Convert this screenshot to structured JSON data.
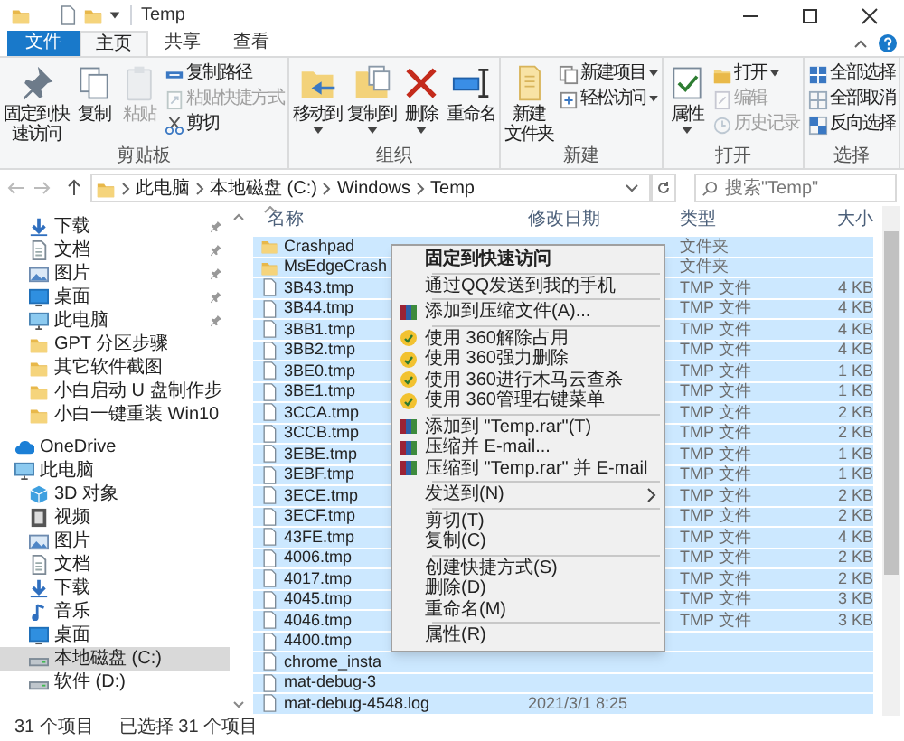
{
  "window": {
    "title": "Temp"
  },
  "ribbon_tabs": [
    {
      "label": "文件",
      "kind": "file",
      "selected": false
    },
    {
      "label": "主页",
      "kind": "tab",
      "selected": true
    },
    {
      "label": "共享",
      "kind": "tab",
      "selected": false
    },
    {
      "label": "查看",
      "kind": "tab",
      "selected": false
    }
  ],
  "ribbon_groups": [
    {
      "label": "剪贴板",
      "buttons": [
        {
          "label": [
            "固定到快",
            "速访问"
          ],
          "kind": "large",
          "disabled": false,
          "dropdown": false
        },
        {
          "label": "复制",
          "kind": "large",
          "disabled": false,
          "dropdown": false
        },
        {
          "label": "粘贴",
          "kind": "large",
          "disabled": true,
          "dropdown": false
        },
        {
          "label": "复制路径",
          "kind": "small",
          "disabled": false,
          "dropdown": false
        },
        {
          "label": "粘贴快捷方式",
          "kind": "small",
          "disabled": true,
          "dropdown": false
        },
        {
          "label": "剪切",
          "kind": "small",
          "disabled": false,
          "dropdown": false
        }
      ]
    },
    {
      "label": "组织",
      "buttons": [
        {
          "label": "移动到",
          "kind": "large",
          "disabled": false,
          "dropdown": true
        },
        {
          "label": "复制到",
          "kind": "large",
          "disabled": false,
          "dropdown": true
        },
        {
          "label": "删除",
          "kind": "large",
          "disabled": false,
          "dropdown": true
        },
        {
          "label": "重命名",
          "kind": "large",
          "disabled": false,
          "dropdown": false
        }
      ]
    },
    {
      "label": "新建",
      "buttons": [
        {
          "label": [
            "新建",
            "文件夹"
          ],
          "kind": "large",
          "disabled": false,
          "dropdown": false
        },
        {
          "label": "新建项目",
          "kind": "small",
          "disabled": false,
          "dropdown": true
        },
        {
          "label": "轻松访问",
          "kind": "small",
          "disabled": false,
          "dropdown": true
        }
      ]
    },
    {
      "label": "打开",
      "buttons": [
        {
          "label": "属性",
          "kind": "large",
          "disabled": false,
          "dropdown": true
        },
        {
          "label": "打开",
          "kind": "small",
          "disabled": false,
          "dropdown": true
        },
        {
          "label": "编辑",
          "kind": "small",
          "disabled": true,
          "dropdown": false
        },
        {
          "label": "历史记录",
          "kind": "small",
          "disabled": true,
          "dropdown": false
        }
      ]
    },
    {
      "label": "选择",
      "buttons": [
        {
          "label": "全部选择",
          "kind": "small",
          "disabled": false,
          "dropdown": false
        },
        {
          "label": "全部取消",
          "kind": "small",
          "disabled": false,
          "dropdown": false
        },
        {
          "label": "反向选择",
          "kind": "small",
          "disabled": false,
          "dropdown": false
        }
      ]
    }
  ],
  "address": {
    "path": [
      "此电脑",
      "本地磁盘 (C:)",
      "Windows",
      "Temp"
    ]
  },
  "search": {
    "placeholder": "搜索\"Temp\""
  },
  "navigation": {
    "quick_access": [
      {
        "label": "下载",
        "kind": "download",
        "pinned": true
      },
      {
        "label": "文档",
        "kind": "document",
        "pinned": true
      },
      {
        "label": "图片",
        "kind": "picture",
        "pinned": true
      },
      {
        "label": "桌面",
        "kind": "desktop",
        "pinned": true
      },
      {
        "label": "此电脑",
        "kind": "computer",
        "pinned": true
      },
      {
        "label": "GPT 分区步骤",
        "kind": "folder",
        "pinned": false
      },
      {
        "label": "其它软件截图",
        "kind": "folder",
        "pinned": false
      },
      {
        "label": "小白启动 U 盘制作步",
        "kind": "folder",
        "pinned": false
      },
      {
        "label": "小白一键重装 Win10",
        "kind": "folder",
        "pinned": false
      }
    ],
    "tree": [
      {
        "label": "OneDrive",
        "kind": "cloud",
        "selected": false
      },
      {
        "label": "此电脑",
        "kind": "computer",
        "selected": false,
        "children": [
          {
            "label": "3D 对象",
            "kind": "cube",
            "selected": false
          },
          {
            "label": "视频",
            "kind": "video",
            "selected": false
          },
          {
            "label": "图片",
            "kind": "picture",
            "selected": false
          },
          {
            "label": "文档",
            "kind": "document",
            "selected": false
          },
          {
            "label": "下载",
            "kind": "download",
            "selected": false
          },
          {
            "label": "音乐",
            "kind": "music",
            "selected": false
          },
          {
            "label": "桌面",
            "kind": "desktop",
            "selected": false
          },
          {
            "label": "本地磁盘 (C:)",
            "kind": "drive",
            "selected": true
          },
          {
            "label": "软件 (D:)",
            "kind": "drive",
            "selected": false
          }
        ]
      }
    ]
  },
  "file_list": {
    "columns": [
      "名称",
      "修改日期",
      "类型",
      "大小"
    ],
    "rows": [
      {
        "name": "Crashpad",
        "kind": "folder",
        "type": "文件夹",
        "selected": true
      },
      {
        "name": "MsEdgeCrash",
        "kind": "folder",
        "type": "文件夹",
        "selected": true
      },
      {
        "name": "3B43.tmp",
        "kind": "file",
        "type": "TMP 文件",
        "size": "4 KB",
        "selected": true
      },
      {
        "name": "3B44.tmp",
        "kind": "file",
        "type": "TMP 文件",
        "size": "4 KB",
        "selected": true
      },
      {
        "name": "3BB1.tmp",
        "kind": "file",
        "type": "TMP 文件",
        "size": "4 KB",
        "selected": true
      },
      {
        "name": "3BB2.tmp",
        "kind": "file",
        "type": "TMP 文件",
        "size": "4 KB",
        "selected": true
      },
      {
        "name": "3BE0.tmp",
        "kind": "file",
        "type": "TMP 文件",
        "size": "1 KB",
        "selected": true
      },
      {
        "name": "3BE1.tmp",
        "kind": "file",
        "type": "TMP 文件",
        "size": "1 KB",
        "selected": true
      },
      {
        "name": "3CCA.tmp",
        "kind": "file",
        "type": "TMP 文件",
        "size": "2 KB",
        "selected": true
      },
      {
        "name": "3CCB.tmp",
        "kind": "file",
        "type": "TMP 文件",
        "size": "2 KB",
        "selected": true
      },
      {
        "name": "3EBE.tmp",
        "kind": "file",
        "type": "TMP 文件",
        "size": "1 KB",
        "selected": true
      },
      {
        "name": "3EBF.tmp",
        "kind": "file",
        "type": "TMP 文件",
        "size": "1 KB",
        "selected": true
      },
      {
        "name": "3ECE.tmp",
        "kind": "file",
        "type": "TMP 文件",
        "size": "2 KB",
        "selected": true
      },
      {
        "name": "3ECF.tmp",
        "kind": "file",
        "type": "TMP 文件",
        "size": "2 KB",
        "selected": true
      },
      {
        "name": "43FE.tmp",
        "kind": "file",
        "type": "TMP 文件",
        "size": "4 KB",
        "selected": true
      },
      {
        "name": "4006.tmp",
        "kind": "file",
        "type": "TMP 文件",
        "size": "2 KB",
        "selected": true
      },
      {
        "name": "4017.tmp",
        "kind": "file",
        "type": "TMP 文件",
        "size": "2 KB",
        "selected": true
      },
      {
        "name": "4045.tmp",
        "kind": "file",
        "type": "TMP 文件",
        "size": "3 KB",
        "selected": true
      },
      {
        "name": "4046.tmp",
        "kind": "file",
        "type": "TMP 文件",
        "size": "3 KB",
        "selected": true
      },
      {
        "name": "4400.tmp",
        "kind": "file",
        "selected": true
      },
      {
        "name": "chrome_insta",
        "kind": "file",
        "selected": true
      },
      {
        "name": "mat-debug-3",
        "kind": "file",
        "selected": true
      },
      {
        "name": "mat-debug-4548.log",
        "kind": "file",
        "date": "2021/3/1 8:25",
        "selected": true
      }
    ]
  },
  "context_menu": [
    {
      "label": "固定到快速访问",
      "kind": "plain",
      "default": true,
      "separator_after": true
    },
    {
      "label": "通过QQ发送到我的手机",
      "kind": "plain",
      "default": false,
      "separator_after": true
    },
    {
      "label": "添加到压缩文件(A)...",
      "kind": "archive",
      "default": false,
      "separator_after": true
    },
    {
      "label": "使用 360解除占用",
      "kind": "tool",
      "default": false,
      "separator_after": false
    },
    {
      "label": "使用 360强力删除",
      "kind": "tool",
      "default": false,
      "separator_after": false
    },
    {
      "label": "使用 360进行木马云查杀",
      "kind": "tool",
      "default": false,
      "separator_after": false
    },
    {
      "label": "使用 360管理右键菜单",
      "kind": "tool",
      "default": false,
      "separator_after": true
    },
    {
      "label": "添加到 \"Temp.rar\"(T)",
      "kind": "archive",
      "default": false,
      "separator_after": false
    },
    {
      "label": "压缩并 E-mail...",
      "kind": "archive",
      "default": false,
      "separator_after": false
    },
    {
      "label": "压缩到 \"Temp.rar\" 并 E-mail",
      "kind": "archive",
      "default": false,
      "separator_after": true
    },
    {
      "label": "发送到(N)",
      "kind": "submenu",
      "default": false,
      "separator_after": true
    },
    {
      "label": "剪切(T)",
      "kind": "plain",
      "default": false,
      "separator_after": false
    },
    {
      "label": "复制(C)",
      "kind": "plain",
      "default": false,
      "separator_after": true
    },
    {
      "label": "创建快捷方式(S)",
      "kind": "plain",
      "default": false,
      "separator_after": false
    },
    {
      "label": "删除(D)",
      "kind": "plain",
      "default": false,
      "separator_after": false
    },
    {
      "label": "重命名(M)",
      "kind": "plain",
      "default": false,
      "separator_after": true
    },
    {
      "label": "属性(R)",
      "kind": "plain",
      "default": false,
      "separator_after": false
    }
  ],
  "status_bar": [
    "31 个项目",
    "已选择 31 个项目"
  ]
}
